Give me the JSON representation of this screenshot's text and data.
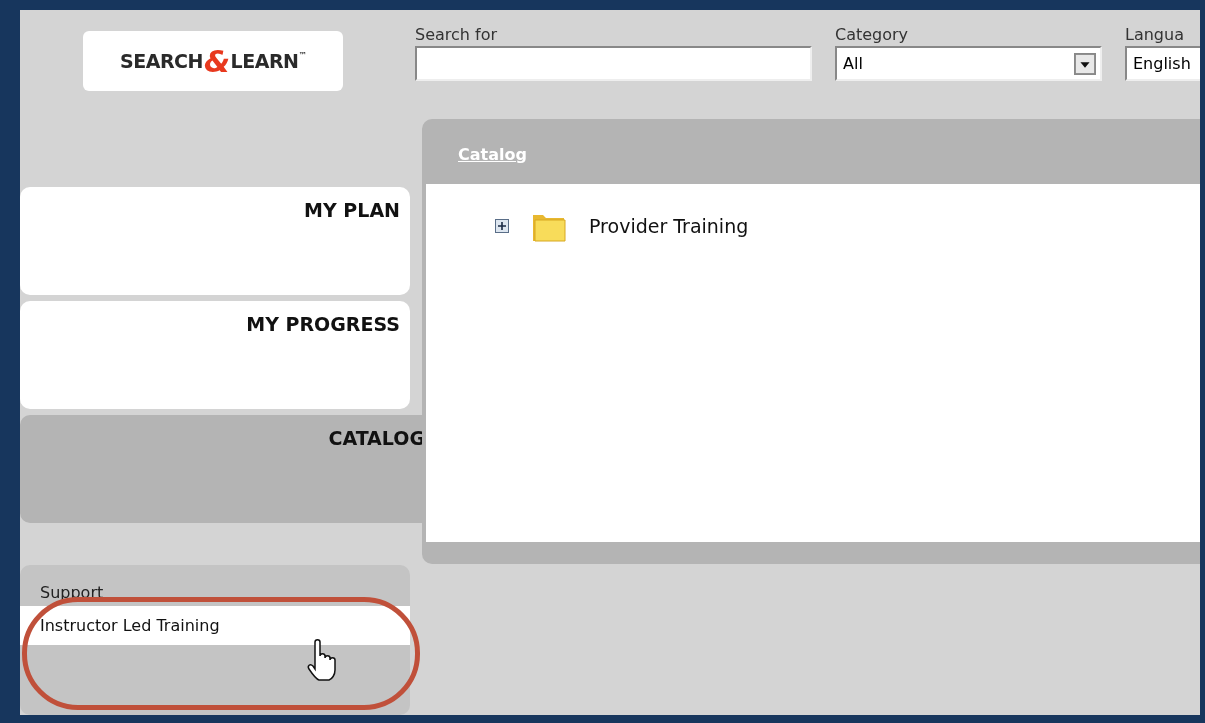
{
  "logo": {
    "text_left": "SEARCH",
    "ampersand": "&",
    "text_right": "LEARN",
    "trademark": "™"
  },
  "search": {
    "label": "Search for"
  },
  "category": {
    "label": "Category",
    "value": "All"
  },
  "language": {
    "label": "Langua",
    "value": "English"
  },
  "nav_tabs": [
    {
      "label": "MY PLAN",
      "selected": false
    },
    {
      "label": "MY PROGRESS",
      "selected": false
    },
    {
      "label": "CATALOG",
      "selected": true
    }
  ],
  "panel": {
    "title": "Catalog",
    "tree": [
      {
        "label": "Provider Training",
        "expanded": false
      }
    ]
  },
  "support": {
    "title": "Support",
    "items": [
      {
        "label": "Instructor Led Training",
        "selected": true
      }
    ]
  }
}
